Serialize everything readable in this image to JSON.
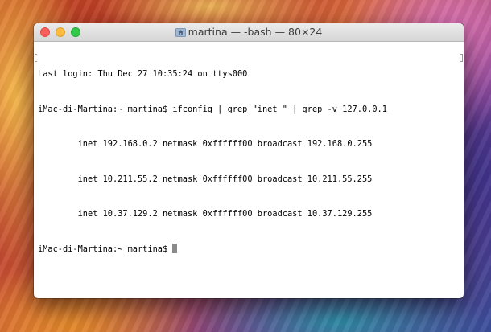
{
  "window": {
    "title": "martina — -bash — 80×24",
    "title_icon": "home-folder-icon"
  },
  "terminal": {
    "lines": [
      "Last login: Thu Dec 27 10:35:24 on ttys000",
      "iMac-di-Martina:~ martina$ ifconfig | grep \"inet \" | grep -v 127.0.0.1",
      "        inet 192.168.0.2 netmask 0xffffff00 broadcast 192.168.0.255",
      "        inet 10.211.55.2 netmask 0xffffff00 broadcast 10.211.55.255",
      "        inet 10.37.129.2 netmask 0xffffff00 broadcast 10.37.129.255"
    ],
    "prompt": "iMac-di-Martina:~ martina$ "
  },
  "colors": {
    "close": "#fc605c",
    "minimize": "#fdbc40",
    "zoom": "#34c84a"
  }
}
